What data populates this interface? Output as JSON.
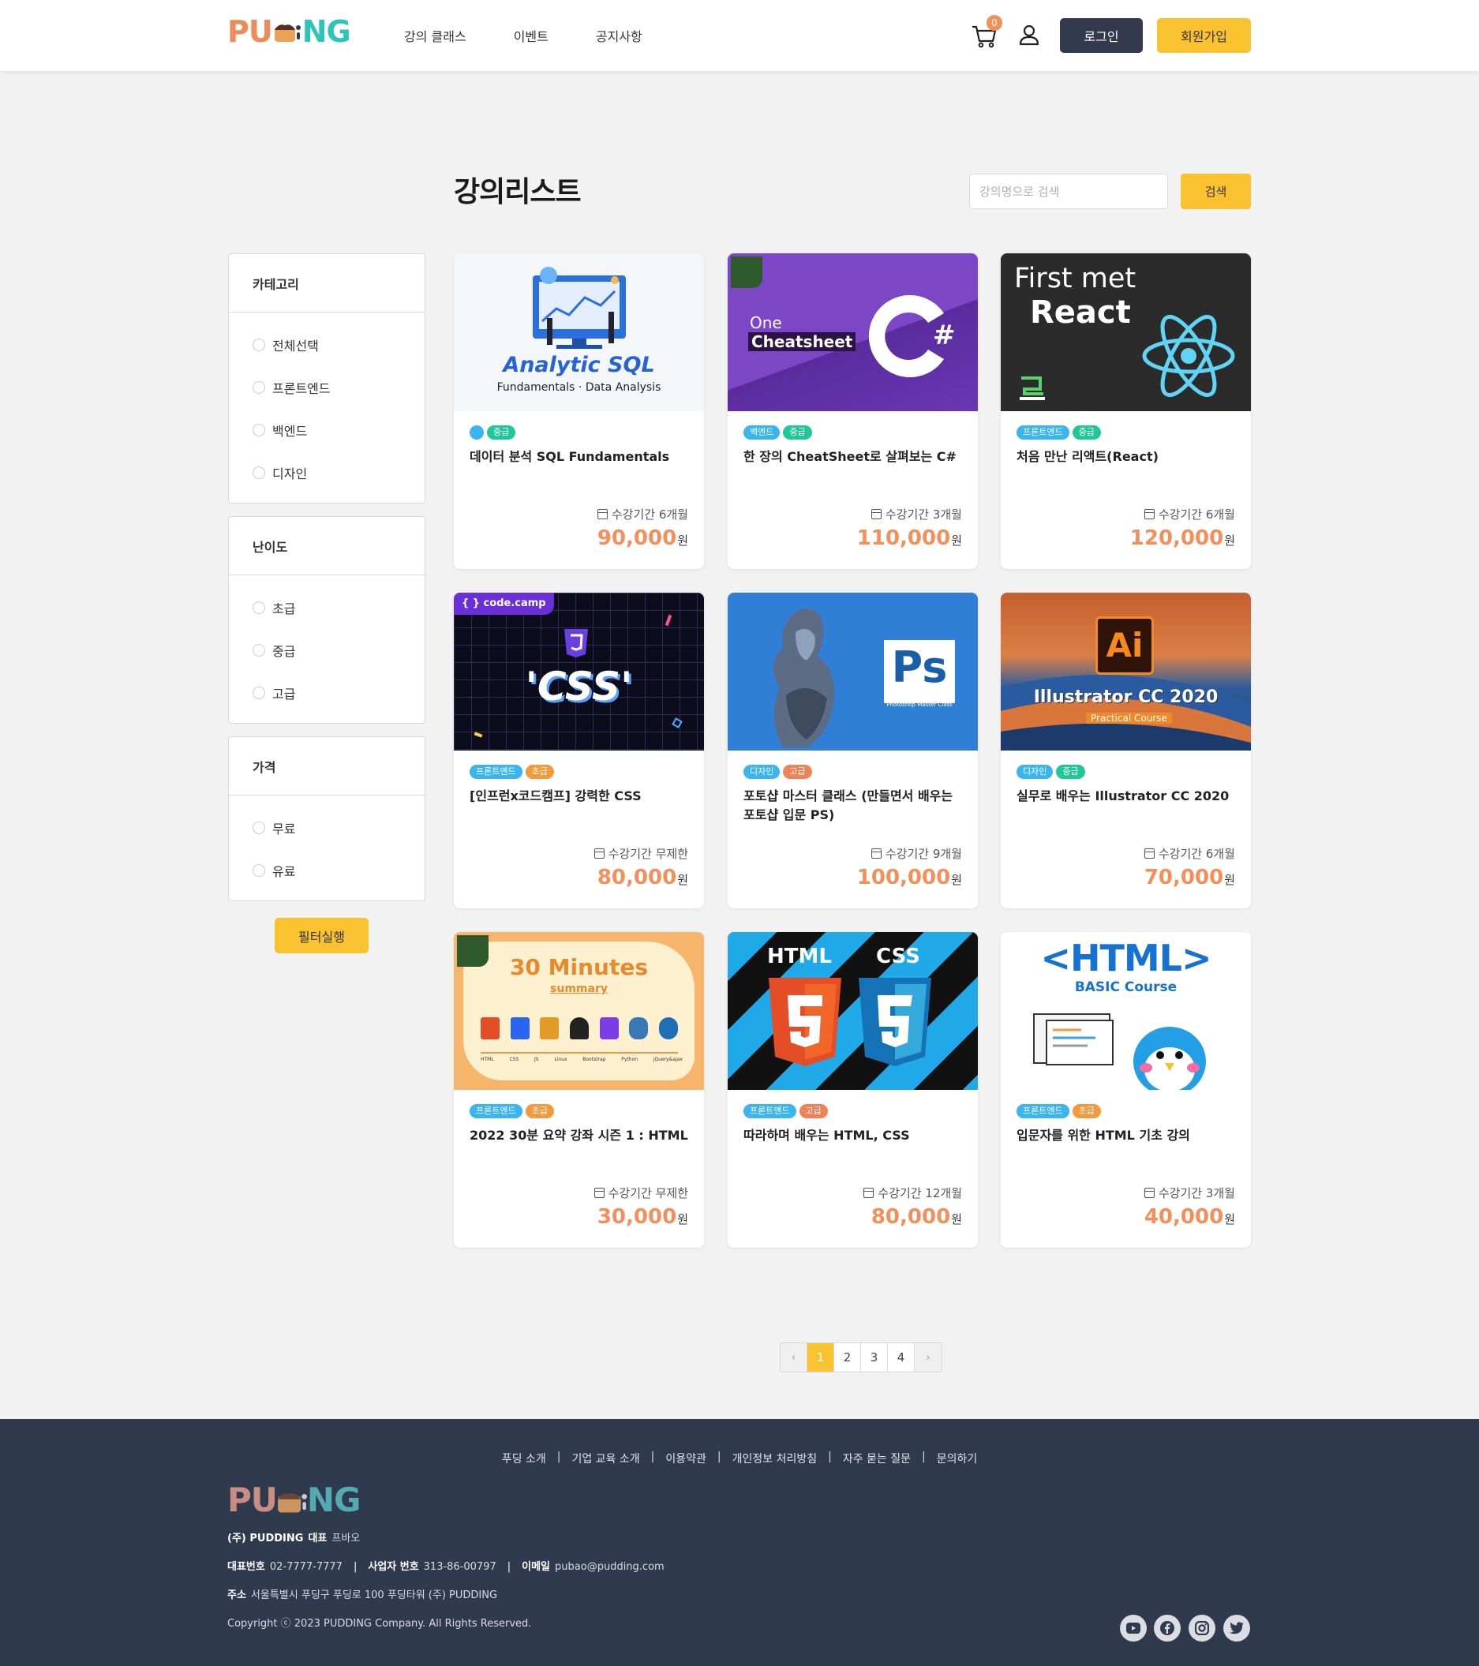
{
  "header": {
    "logo": {
      "left": "PU",
      "right": "NG"
    },
    "nav": [
      "강의 클래스",
      "이벤트",
      "공지사항"
    ],
    "cart_count": "0",
    "login_label": "로그인",
    "signup_label": "회원가입"
  },
  "main": {
    "title": "강의리스트",
    "search_placeholder": "강의명으로 검색",
    "search_label": "검색"
  },
  "filters": {
    "category": {
      "title": "카테고리",
      "options": [
        "전체선택",
        "프론트엔드",
        "백엔드",
        "디자인"
      ]
    },
    "level": {
      "title": "난이도",
      "options": [
        "초급",
        "중급",
        "고급"
      ]
    },
    "price": {
      "title": "가격",
      "options": [
        "무료",
        "유료"
      ]
    },
    "apply_label": "필터실행"
  },
  "courses": [
    {
      "title": "데이터 분석 SQL Fundamentals",
      "tags": [
        "",
        "중급"
      ],
      "period": "수강기간 6개월",
      "price": "90,000",
      "currency": "원",
      "thumb": {
        "line1": "Analytic SQL",
        "line2": "Fundamentals · Data Analysis"
      }
    },
    {
      "title": "한 장의 CheatSheet로 살펴보는 C#",
      "tags": [
        "백엔드",
        "중급"
      ],
      "period": "수강기간 3개월",
      "price": "110,000",
      "currency": "원",
      "thumb": {
        "line1": "One",
        "line2": "Cheatsheet",
        "line3": "C#"
      }
    },
    {
      "title": "처음 만난 리액트(React)",
      "tags": [
        "프론트엔드",
        "중급"
      ],
      "period": "수강기간 6개월",
      "price": "120,000",
      "currency": "원",
      "thumb": {
        "line1": "First met",
        "line2": "React"
      }
    },
    {
      "title": "[인프런x코드캠프] 강력한 CSS",
      "tags": [
        "프론트엔드",
        "초급"
      ],
      "period": "수강기간 무제한",
      "price": "80,000",
      "currency": "원",
      "thumb": {
        "line1": "{ } code.camp",
        "line2": "'CSS'"
      }
    },
    {
      "title": "포토샵 마스터 클래스 (만들면서 배우는 포토샵 입문 PS)",
      "tags": [
        "디자인",
        "고급"
      ],
      "period": "수강기간 9개월",
      "price": "100,000",
      "currency": "원",
      "thumb": {
        "line1": "Ps",
        "line2": "Photoshop Master Class"
      }
    },
    {
      "title": "실무로 배우는 Illustrator CC 2020",
      "tags": [
        "디자인",
        "중급"
      ],
      "period": "수강기간 6개월",
      "price": "70,000",
      "currency": "원",
      "thumb": {
        "line1": "Ai",
        "line2": "Illustrator CC 2020",
        "line3": "Practical Course"
      }
    },
    {
      "title": "2022 30분 요약 강좌 시즌 1 : HTML",
      "tags": [
        "프론트엔드",
        "초급"
      ],
      "period": "수강기간 무제한",
      "price": "30,000",
      "currency": "원",
      "thumb": {
        "line1": "30 Minutes",
        "line2": "summary",
        "labels": [
          "HTML",
          "CSS",
          "JS",
          "Linux",
          "Bootstrap",
          "Python",
          "jQuery&ajax"
        ]
      }
    },
    {
      "title": "따라하며 배우는 HTML, CSS",
      "tags": [
        "프론트엔드",
        "고급"
      ],
      "period": "수강기간 12개월",
      "price": "80,000",
      "currency": "원",
      "thumb": {
        "line1": "HTML",
        "line2": "CSS"
      }
    },
    {
      "title": "입문자를 위한 HTML 기초 강의",
      "tags": [
        "프론트엔드",
        "초급"
      ],
      "period": "수강기간 3개월",
      "price": "40,000",
      "currency": "원",
      "thumb": {
        "line1": "<HTML>",
        "line2": "BASIC Course"
      }
    }
  ],
  "pagination": {
    "prev": "‹",
    "pages": [
      "1",
      "2",
      "3",
      "4"
    ],
    "next": "›"
  },
  "footer": {
    "links": [
      "푸딩 소개",
      "기업 교육 소개",
      "이용약관",
      "개인정보 처리방침",
      "자주 묻는 질문",
      "문의하기"
    ],
    "separator": "|",
    "company": "(주) PUDDING",
    "ceo_label": "대표",
    "ceo": "프바오",
    "phone_label": "대표번호",
    "phone": "02-7777-7777",
    "biz_label": "사업자 번호",
    "biz": "313-86-00797",
    "email_label": "이메일",
    "email": "pubao@pudding.com",
    "address_label": "주소",
    "address": "서울특별시 푸딩구 푸딩로 100 푸딩타워 (주) PUDDING",
    "copyright": "Copyright ⓒ 2023 PUDDING Company. All Rights Reserved."
  }
}
